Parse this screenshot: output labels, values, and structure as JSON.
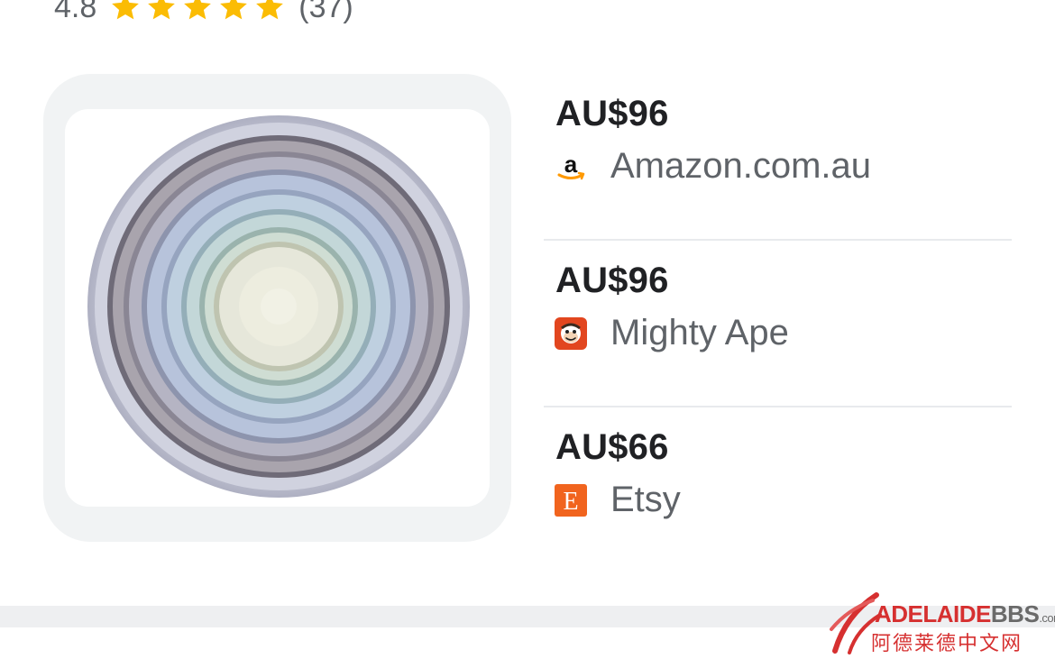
{
  "rating": {
    "score": "4.8",
    "stars": 5,
    "count": "(37)"
  },
  "product_image": {
    "alt": "nested bowls"
  },
  "offers": [
    {
      "price": "AU$96",
      "merchant": "Amazon.com.au",
      "logo_icon": "amazon-logo-icon"
    },
    {
      "price": "AU$96",
      "merchant": "Mighty Ape",
      "logo_icon": "mighty-ape-logo-icon"
    },
    {
      "price": "AU$66",
      "merchant": "Etsy",
      "logo_icon": "etsy-logo-icon"
    }
  ],
  "watermark": {
    "latin": "ADELAIDE",
    "latin_accent": "BBS",
    "domain_suffix": ".com",
    "cjk": "阿德莱德中文网"
  },
  "colors": {
    "star": "#fbbc04",
    "price_text": "#202124",
    "merchant_text": "#5f6368",
    "tile_bg": "#f1f3f4",
    "divider": "#e8eaed",
    "etsy": "#f1641e",
    "amazon_smile": "#ff9900",
    "mighty_ape": "#e2461f",
    "watermark_red": "#d63030"
  }
}
